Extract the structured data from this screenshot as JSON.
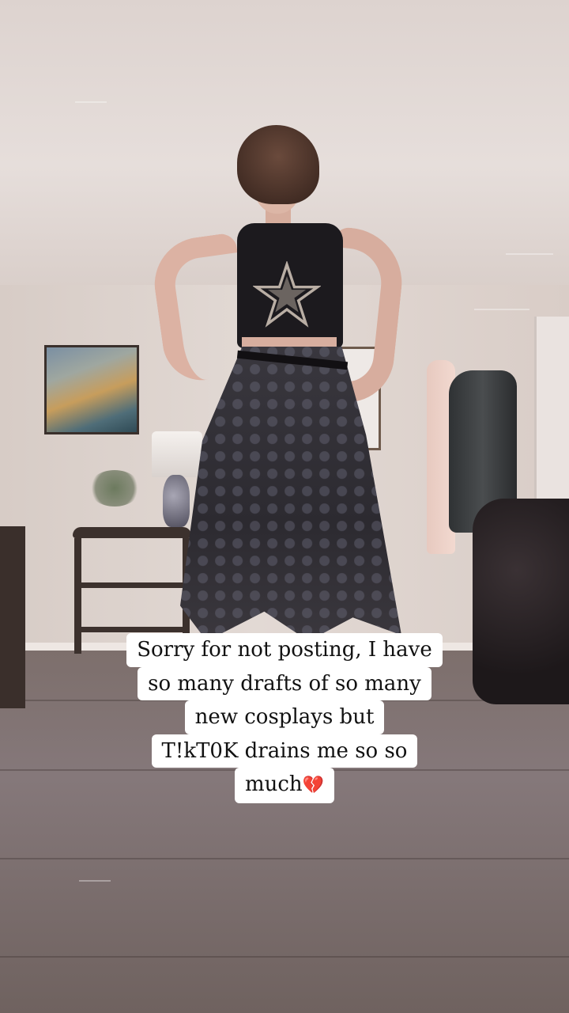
{
  "caption": {
    "line1": "Sorry for not posting, I have",
    "line2": "so many drafts of so many",
    "line3": "new cosplays but",
    "line4": "T!kT0K drains me so so",
    "line5_text": "much",
    "line5_emoji": "💔"
  },
  "colors": {
    "caption_background": "#ffffff",
    "caption_text": "#111111",
    "emoji_red": "#d1313d"
  }
}
